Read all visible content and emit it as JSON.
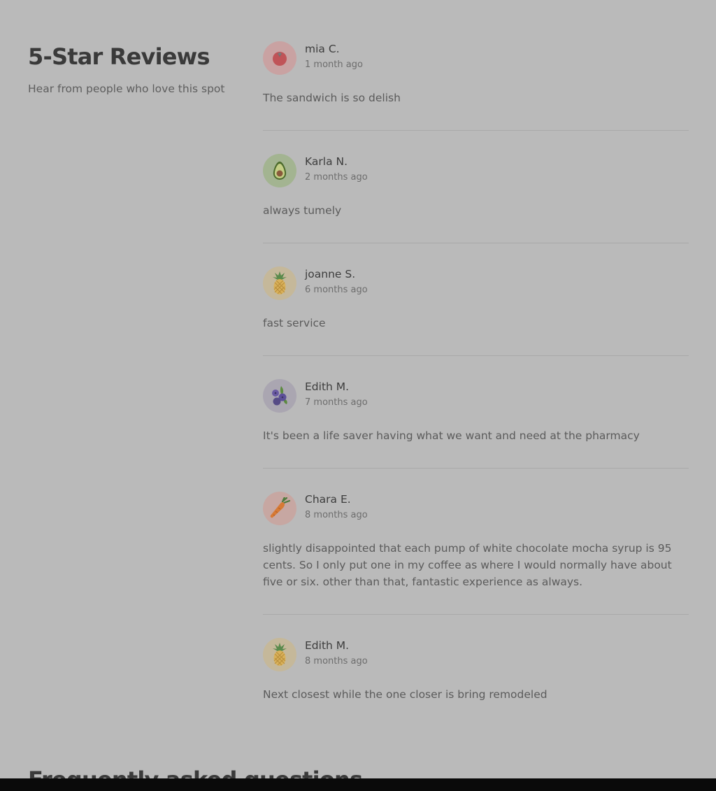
{
  "section": {
    "title": "5-Star Reviews",
    "subtitle": "Hear from people who love this spot"
  },
  "reviews": [
    {
      "name": "mia C.",
      "time": "1 month ago",
      "text": "The sandwich is so delish",
      "avatar_icon": "tomato-icon",
      "avatar_bg": "#c9a2a2"
    },
    {
      "name": "Karla N.",
      "time": "2 months ago",
      "text": "always tumely",
      "avatar_icon": "avocado-icon",
      "avatar_bg": "#a3b491"
    },
    {
      "name": "joanne S.",
      "time": "6 months ago",
      "text": "fast service",
      "avatar_icon": "pineapple-icon",
      "avatar_bg": "#c5b89a"
    },
    {
      "name": "Edith M.",
      "time": "7 months ago",
      "text": "It's been a life saver having what we want and need at the pharmacy",
      "avatar_icon": "blueberries-icon",
      "avatar_bg": "#aaa6b1"
    },
    {
      "name": "Chara E.",
      "time": "8 months ago",
      "text": "slightly disappointed that each pump of white chocolate mocha syrup is 95 cents. So I only put one in my coffee as where I would normally have about five or six. other than that, fantastic experience as always.",
      "avatar_icon": "carrot-icon",
      "avatar_bg": "#c7a7a2"
    },
    {
      "name": "Edith M.",
      "time": "8 months ago",
      "text": "Next closest while the one closer is bring remodeled",
      "avatar_icon": "pineapple-icon",
      "avatar_bg": "#c5b89a"
    }
  ],
  "faq": {
    "title": "Frequently asked questions"
  },
  "colors": {
    "background": "#bababa",
    "text": "#3c3c3c",
    "divider": "#a9a9a9",
    "bottom_bar": "#0a0a0a"
  }
}
